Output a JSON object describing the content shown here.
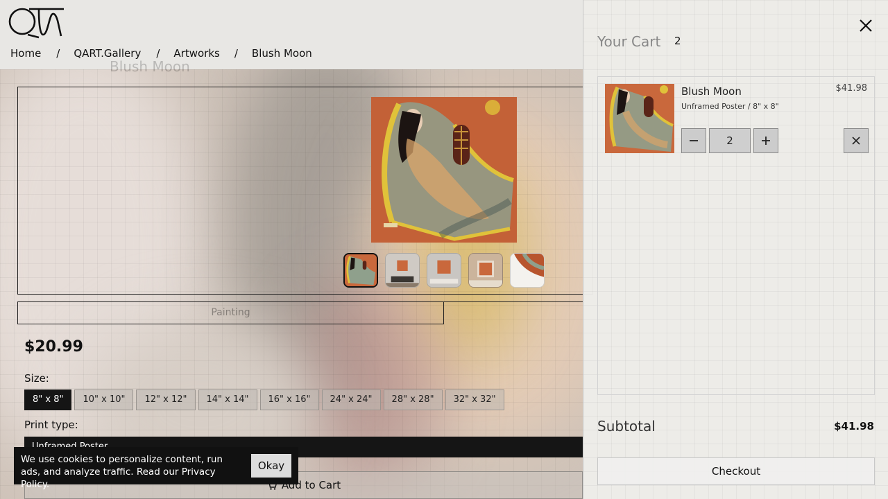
{
  "header": {
    "logo_alt": "QART logo",
    "breadcrumb": [
      {
        "label": "Home"
      },
      {
        "label": "QART.Gallery"
      },
      {
        "label": "Artworks"
      },
      {
        "label": "Blush Moon"
      }
    ],
    "separator": "/"
  },
  "product": {
    "ghost_title": "Blush Moon",
    "category_tab": "Painting",
    "price": "$20.99",
    "size_label": "Size:",
    "sizes": [
      "8\" x 8\"",
      "10\" x 10\"",
      "12\" x 12\"",
      "14\" x 14\"",
      "16\" x 16\"",
      "24\" x 24\"",
      "28\" x 28\"",
      "32\" x 32\""
    ],
    "selected_size": "8\" x 8\"",
    "print_type_label": "Print type:",
    "print_type_value": "Unframed Poster",
    "add_to_cart": "Add to Cart",
    "thumbnail_count": 5
  },
  "cookie": {
    "text": "We use cookies to personalize content, run ads, and analyze traffic. Read our",
    "link": "Privacy Policy",
    "after_link": ".",
    "button": "Okay"
  },
  "cart": {
    "title": "Your Cart",
    "count": "2",
    "items": [
      {
        "name": "Blush Moon",
        "price": "$41.98",
        "variant": "Unframed Poster / 8\" x 8\"",
        "quantity": "2"
      }
    ],
    "subtotal_label": "Subtotal",
    "subtotal_value": "$41.98",
    "checkout": "Checkout"
  },
  "colors": {
    "accent_dark": "#151515",
    "painting_orange": "#c9683c",
    "painting_gold": "#d9b83a"
  }
}
